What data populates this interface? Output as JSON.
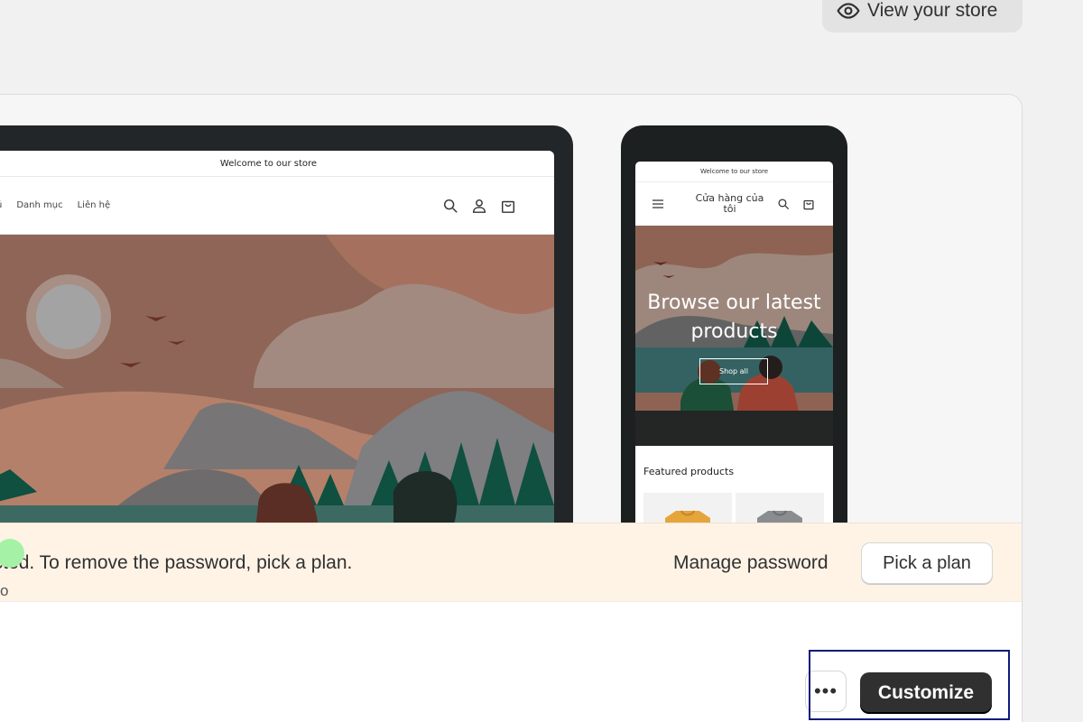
{
  "header": {
    "view_store_label": "View your store",
    "view_store_icon": "eye-icon"
  },
  "desktop_preview": {
    "announcement": "Welcome to our store",
    "nav_items": [
      "ú",
      "Danh mục",
      "Liên hệ"
    ],
    "icons": [
      "search-icon",
      "account-icon",
      "cart-icon"
    ]
  },
  "mobile_preview": {
    "announcement": "Welcome to our store",
    "store_title": "Cửa hàng của tôi",
    "hero_title": "Browse our latest products",
    "shop_button": "Shop all",
    "featured_heading": "Featured products"
  },
  "banner": {
    "message": "ected. To remove the password, pick a plan.",
    "manage_password": "Manage password",
    "pick_plan": "Pick a plan"
  },
  "theme_info": {
    "stray_text": "o"
  },
  "actions": {
    "more_label": "•••",
    "customize_label": "Customize"
  },
  "colors": {
    "primary_button": "#303030",
    "banner_bg": "#fff3e6",
    "status_green": "#a5f2a7",
    "focus_outline": "#0f1a78"
  }
}
